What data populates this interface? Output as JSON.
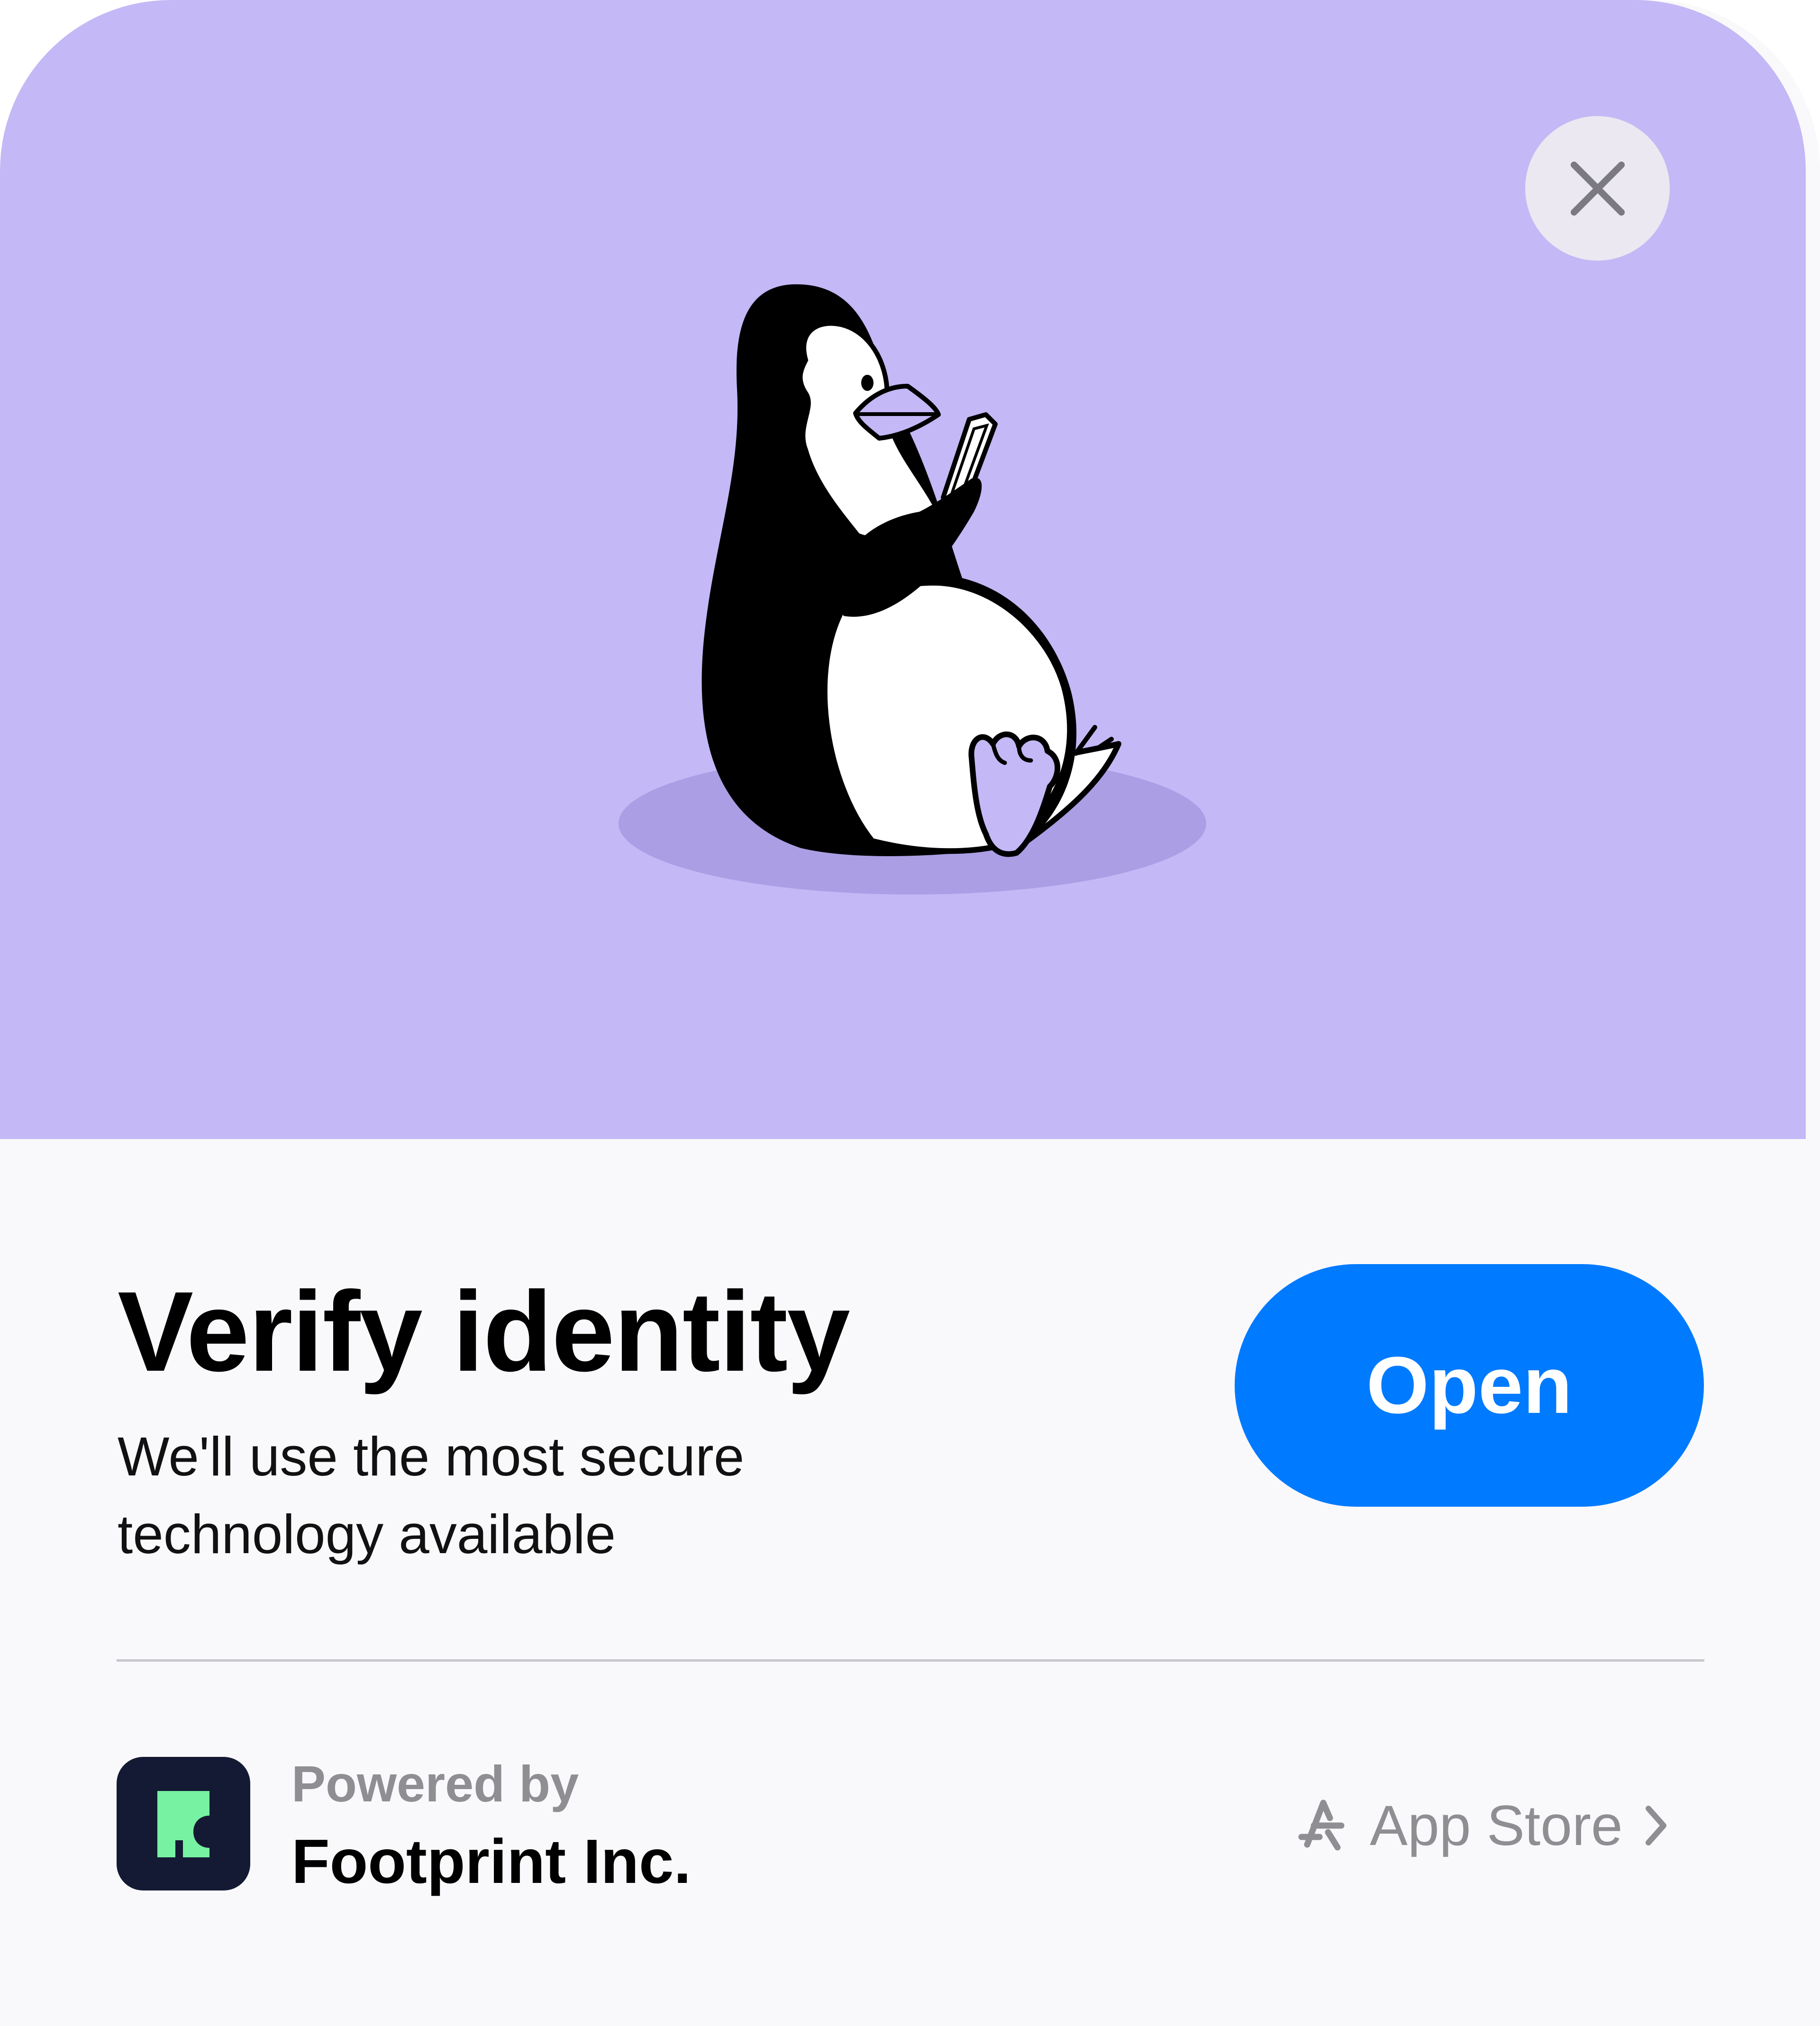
{
  "card": {
    "title": "Verify identity",
    "subtitle": "We'll use the most secure technology available",
    "open_button_label": "Open"
  },
  "footer": {
    "powered_by_label": "Powered by",
    "company_name": "Footprint Inc.",
    "store_link_label": "App Store"
  },
  "icons": {
    "close": "close-icon",
    "store": "app-store-icon",
    "chevron": "chevron-right-icon",
    "logo": "footprint-logo"
  },
  "colors": {
    "hero_background": "#c4b8f6",
    "accent": "#007aff",
    "logo_background": "#141a33",
    "logo_mark": "#76f2a2",
    "secondary_text": "#8e8e93"
  }
}
